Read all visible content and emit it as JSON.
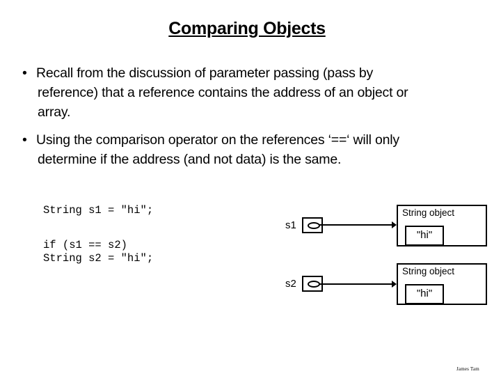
{
  "slide": {
    "title": "Comparing Objects",
    "bullets": [
      {
        "marker": "•",
        "lines": [
          "Recall from the discussion of parameter passing (pass by",
          "reference) that a reference contains the address of an object or",
          "array."
        ]
      },
      {
        "marker": "•",
        "lines": [
          "Using the comparison operator on the references ‘==‘ will only",
          "determine if the address (and not data) is the same."
        ]
      }
    ],
    "code_declarations": [
      "String s1 = \"hi\";",
      "String s2 = \"hi\";"
    ],
    "code_comparison": "if (s1 == s2)",
    "diagram": {
      "references": [
        {
          "name": "s1",
          "object_label": "String object",
          "object_value": "\"hi\""
        },
        {
          "name": "s2",
          "object_label": "String object",
          "object_value": "\"hi\""
        }
      ]
    },
    "footer": "James Tam"
  }
}
